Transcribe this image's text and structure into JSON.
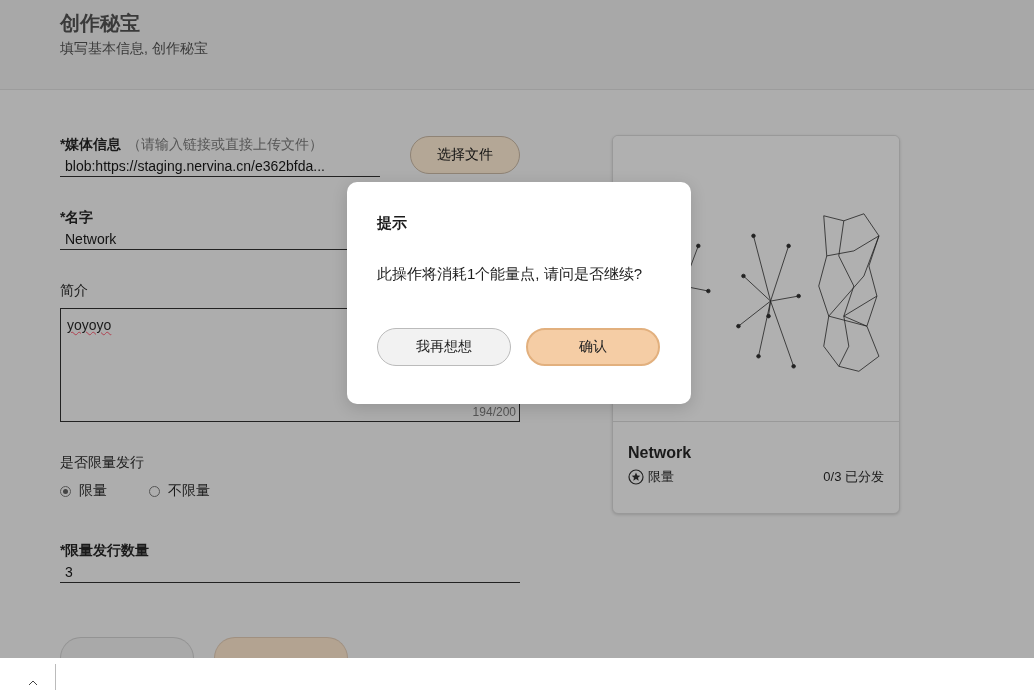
{
  "header": {
    "title": "创作秘宝",
    "subtitle": "填写基本信息, 创作秘宝"
  },
  "form": {
    "media": {
      "label": "*媒体信息",
      "hint": "（请输入链接或直接上传文件）",
      "value": "blob:https://staging.nervina.cn/e362bfda..."
    },
    "choose_file_button": "选择文件",
    "name": {
      "label": "*名字",
      "value": "Network"
    },
    "intro": {
      "label": "简介",
      "value": "yoyoyo",
      "counter": "194/200"
    },
    "limit": {
      "label": "是否限量发行",
      "options": [
        {
          "label": "限量",
          "selected": true
        },
        {
          "label": "不限量",
          "selected": false
        }
      ]
    },
    "quantity": {
      "label": "*限量发行数量",
      "value": "3"
    },
    "buttons": [
      {
        "kind": "secondary"
      },
      {
        "kind": "primary"
      }
    ]
  },
  "preview_card": {
    "title": "Network",
    "badge": "限量",
    "count": "0/3 已分发"
  },
  "dialog": {
    "title": "提示",
    "message": "此操作将消耗1个能量点, 请问是否继续?",
    "buttons": [
      {
        "label": "我再想想",
        "kind": "secondary"
      },
      {
        "label": "确认",
        "kind": "primary"
      }
    ]
  }
}
